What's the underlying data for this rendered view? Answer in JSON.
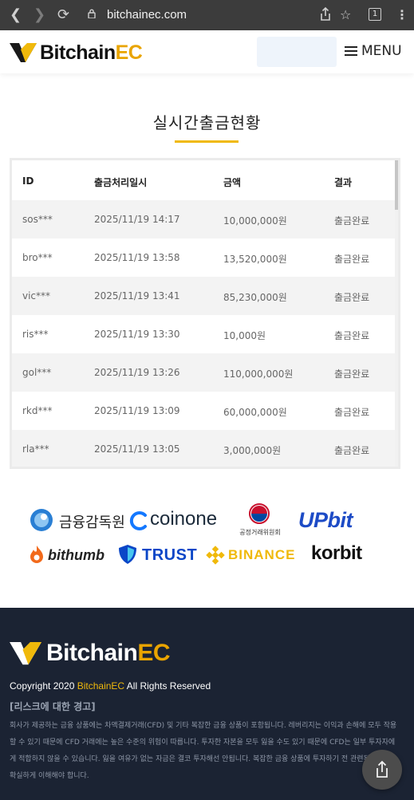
{
  "browser": {
    "url": "bitchainec.com",
    "tab_count": "1"
  },
  "header": {
    "logo_main": "Bitchain",
    "logo_accent": "EC",
    "menu_label": "MENU"
  },
  "withdrawals": {
    "title": "실시간출금현황",
    "columns": [
      "ID",
      "출금처리일시",
      "금액",
      "결과"
    ],
    "rows": [
      {
        "id": "sos***",
        "date": "2025/11/19 14:17",
        "amount": "10,000,000원",
        "result": "출금완료"
      },
      {
        "id": "bro***",
        "date": "2025/11/19 13:58",
        "amount": "13,520,000원",
        "result": "출금완료"
      },
      {
        "id": "vic***",
        "date": "2025/11/19 13:41",
        "amount": "85,230,000원",
        "result": "출금완료"
      },
      {
        "id": "ris***",
        "date": "2025/11/19 13:30",
        "amount": "10,000원",
        "result": "출금완료"
      },
      {
        "id": "gol***",
        "date": "2025/11/19 13:26",
        "amount": "110,000,000원",
        "result": "출금완료"
      },
      {
        "id": "rkd***",
        "date": "2025/11/19 13:09",
        "amount": "60,000,000원",
        "result": "출금완료"
      },
      {
        "id": "rla***",
        "date": "2025/11/19 13:05",
        "amount": "3,000,000원",
        "result": "출금완료"
      }
    ]
  },
  "partners": {
    "fss": "금융감독원",
    "coinone": "coinone",
    "ftc": "공정거래위원회",
    "upbit": "UPbit",
    "bithumb": "bithumb",
    "trust": "TRUST",
    "binance": "BINANCE",
    "korbit": "korbit"
  },
  "footer": {
    "logo_main": "Bitchain",
    "logo_accent": "EC",
    "copyright_prefix": "Copyright 2020 ",
    "copyright_brand": "BitchainEC",
    "copyright_suffix": " All Rights Reserved",
    "risk_title": "[리스크에 대한 경고]",
    "risk_text": "회사가 제공하는 금융 상품에는 차액결제거래(CFD) 및 기타 복잡한 금융 상품이 포함됩니다. 레버리지는 이익과 손해에 모두 작용할 수 있기 때문에 CFD 거래에는 높은 수준의 위험이 따릅니다. 투자한 자본을 모두 잃을 수도 있기 때문에 CFD는 일부 투자자에게 적합하지 않을 수 있습니다. 잃을 여유가 없는 자금은 결코 투자해선 안됩니다. 복잡한 금융 상품에 투자하기 전 관련된 위험을 확실하게 이해해야 합니다."
  },
  "colors": {
    "accent": "#f0b90b",
    "footer_bg": "#1b2333",
    "row_stripe": "#f3f3f3"
  }
}
